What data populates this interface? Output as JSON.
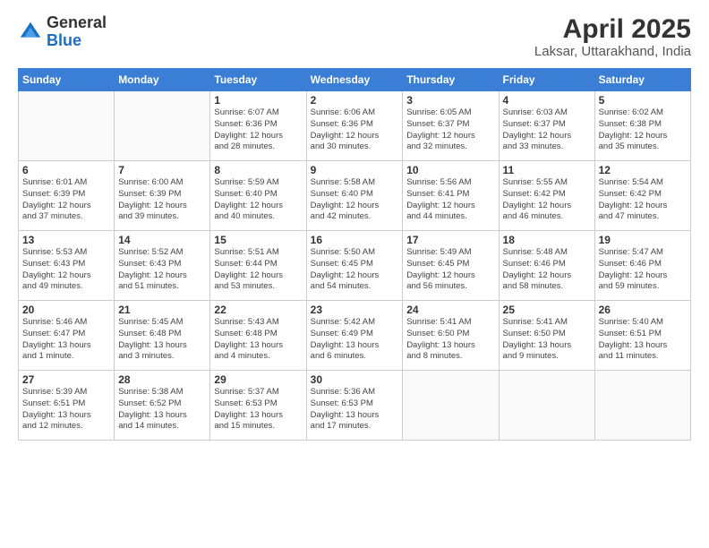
{
  "logo": {
    "general": "General",
    "blue": "Blue"
  },
  "title": "April 2025",
  "subtitle": "Laksar, Uttarakhand, India",
  "days_of_week": [
    "Sunday",
    "Monday",
    "Tuesday",
    "Wednesday",
    "Thursday",
    "Friday",
    "Saturday"
  ],
  "weeks": [
    [
      {
        "num": "",
        "info": ""
      },
      {
        "num": "",
        "info": ""
      },
      {
        "num": "1",
        "info": "Sunrise: 6:07 AM\nSunset: 6:36 PM\nDaylight: 12 hours\nand 28 minutes."
      },
      {
        "num": "2",
        "info": "Sunrise: 6:06 AM\nSunset: 6:36 PM\nDaylight: 12 hours\nand 30 minutes."
      },
      {
        "num": "3",
        "info": "Sunrise: 6:05 AM\nSunset: 6:37 PM\nDaylight: 12 hours\nand 32 minutes."
      },
      {
        "num": "4",
        "info": "Sunrise: 6:03 AM\nSunset: 6:37 PM\nDaylight: 12 hours\nand 33 minutes."
      },
      {
        "num": "5",
        "info": "Sunrise: 6:02 AM\nSunset: 6:38 PM\nDaylight: 12 hours\nand 35 minutes."
      }
    ],
    [
      {
        "num": "6",
        "info": "Sunrise: 6:01 AM\nSunset: 6:39 PM\nDaylight: 12 hours\nand 37 minutes."
      },
      {
        "num": "7",
        "info": "Sunrise: 6:00 AM\nSunset: 6:39 PM\nDaylight: 12 hours\nand 39 minutes."
      },
      {
        "num": "8",
        "info": "Sunrise: 5:59 AM\nSunset: 6:40 PM\nDaylight: 12 hours\nand 40 minutes."
      },
      {
        "num": "9",
        "info": "Sunrise: 5:58 AM\nSunset: 6:40 PM\nDaylight: 12 hours\nand 42 minutes."
      },
      {
        "num": "10",
        "info": "Sunrise: 5:56 AM\nSunset: 6:41 PM\nDaylight: 12 hours\nand 44 minutes."
      },
      {
        "num": "11",
        "info": "Sunrise: 5:55 AM\nSunset: 6:42 PM\nDaylight: 12 hours\nand 46 minutes."
      },
      {
        "num": "12",
        "info": "Sunrise: 5:54 AM\nSunset: 6:42 PM\nDaylight: 12 hours\nand 47 minutes."
      }
    ],
    [
      {
        "num": "13",
        "info": "Sunrise: 5:53 AM\nSunset: 6:43 PM\nDaylight: 12 hours\nand 49 minutes."
      },
      {
        "num": "14",
        "info": "Sunrise: 5:52 AM\nSunset: 6:43 PM\nDaylight: 12 hours\nand 51 minutes."
      },
      {
        "num": "15",
        "info": "Sunrise: 5:51 AM\nSunset: 6:44 PM\nDaylight: 12 hours\nand 53 minutes."
      },
      {
        "num": "16",
        "info": "Sunrise: 5:50 AM\nSunset: 6:45 PM\nDaylight: 12 hours\nand 54 minutes."
      },
      {
        "num": "17",
        "info": "Sunrise: 5:49 AM\nSunset: 6:45 PM\nDaylight: 12 hours\nand 56 minutes."
      },
      {
        "num": "18",
        "info": "Sunrise: 5:48 AM\nSunset: 6:46 PM\nDaylight: 12 hours\nand 58 minutes."
      },
      {
        "num": "19",
        "info": "Sunrise: 5:47 AM\nSunset: 6:46 PM\nDaylight: 12 hours\nand 59 minutes."
      }
    ],
    [
      {
        "num": "20",
        "info": "Sunrise: 5:46 AM\nSunset: 6:47 PM\nDaylight: 13 hours\nand 1 minute."
      },
      {
        "num": "21",
        "info": "Sunrise: 5:45 AM\nSunset: 6:48 PM\nDaylight: 13 hours\nand 3 minutes."
      },
      {
        "num": "22",
        "info": "Sunrise: 5:43 AM\nSunset: 6:48 PM\nDaylight: 13 hours\nand 4 minutes."
      },
      {
        "num": "23",
        "info": "Sunrise: 5:42 AM\nSunset: 6:49 PM\nDaylight: 13 hours\nand 6 minutes."
      },
      {
        "num": "24",
        "info": "Sunrise: 5:41 AM\nSunset: 6:50 PM\nDaylight: 13 hours\nand 8 minutes."
      },
      {
        "num": "25",
        "info": "Sunrise: 5:41 AM\nSunset: 6:50 PM\nDaylight: 13 hours\nand 9 minutes."
      },
      {
        "num": "26",
        "info": "Sunrise: 5:40 AM\nSunset: 6:51 PM\nDaylight: 13 hours\nand 11 minutes."
      }
    ],
    [
      {
        "num": "27",
        "info": "Sunrise: 5:39 AM\nSunset: 6:51 PM\nDaylight: 13 hours\nand 12 minutes."
      },
      {
        "num": "28",
        "info": "Sunrise: 5:38 AM\nSunset: 6:52 PM\nDaylight: 13 hours\nand 14 minutes."
      },
      {
        "num": "29",
        "info": "Sunrise: 5:37 AM\nSunset: 6:53 PM\nDaylight: 13 hours\nand 15 minutes."
      },
      {
        "num": "30",
        "info": "Sunrise: 5:36 AM\nSunset: 6:53 PM\nDaylight: 13 hours\nand 17 minutes."
      },
      {
        "num": "",
        "info": ""
      },
      {
        "num": "",
        "info": ""
      },
      {
        "num": "",
        "info": ""
      }
    ]
  ]
}
